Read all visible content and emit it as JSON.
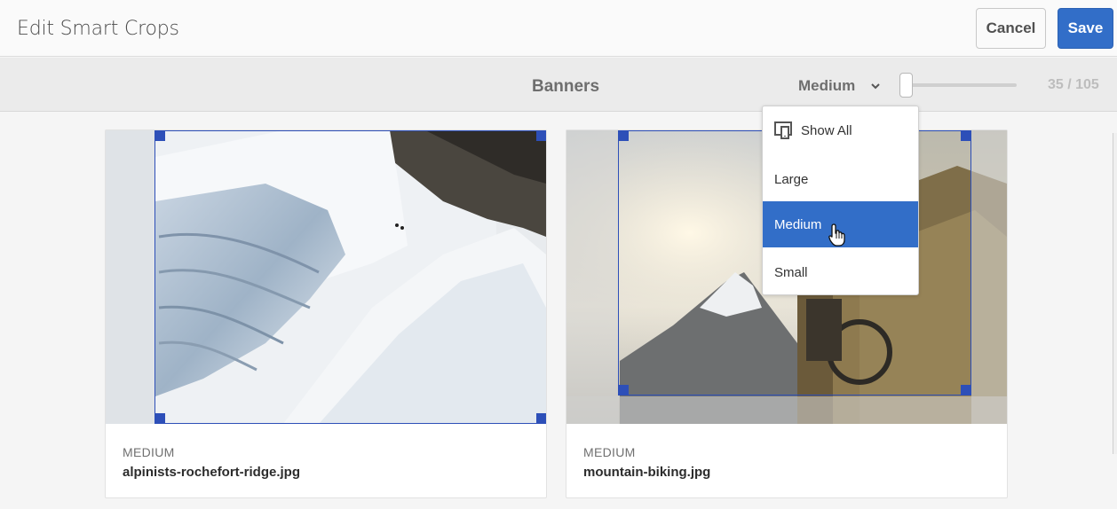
{
  "header": {
    "title": "Edit Smart Crops",
    "cancel_label": "Cancel",
    "save_label": "Save"
  },
  "toolbar": {
    "title": "Banners",
    "size_selected": "Medium",
    "counter": "35 / 105",
    "zoom_level": 0.0
  },
  "dropdown": {
    "items": [
      {
        "label": "Show All",
        "icon": "show-all-devices-icon"
      },
      {
        "label": "Large"
      },
      {
        "label": "Medium",
        "selected": true
      },
      {
        "label": "Small"
      }
    ]
  },
  "cards": [
    {
      "crop_label": "MEDIUM",
      "filename": "alpinists-rochefort-ridge.jpg"
    },
    {
      "crop_label": "MEDIUM",
      "filename": "mountain-biking.jpg"
    }
  ],
  "colors": {
    "accent": "#326ec8",
    "crop_box": "#2d4fb8"
  }
}
